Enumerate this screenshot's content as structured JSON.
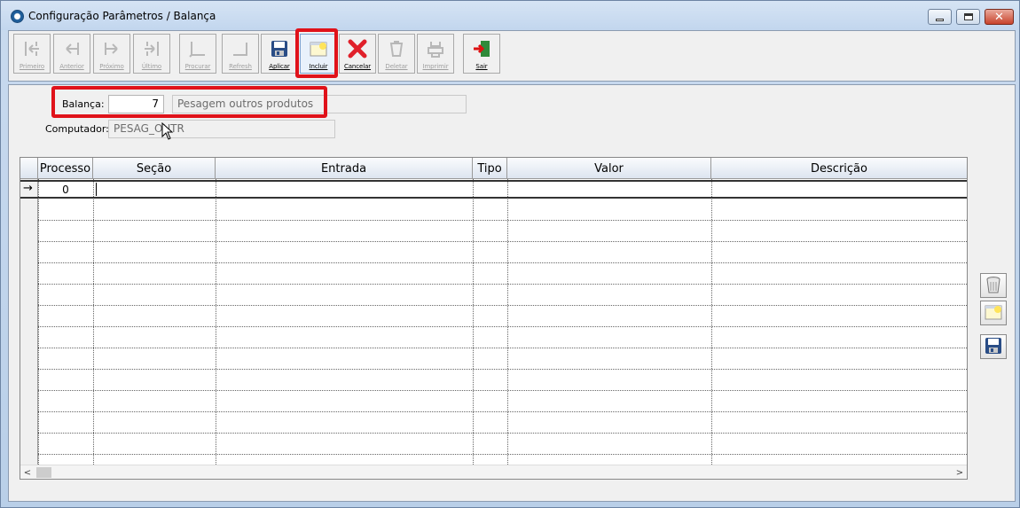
{
  "window": {
    "title": "Configuração Parâmetros / Balança",
    "minimize_icon": "minimize-icon",
    "maximize_icon": "maximize-icon",
    "close_label": "✕"
  },
  "toolbar": {
    "buttons": [
      {
        "label": "Primeiro",
        "icon": "first-record-icon",
        "enabled": false
      },
      {
        "label": "Anterior",
        "icon": "previous-record-icon",
        "enabled": false
      },
      {
        "label": "Próximo",
        "icon": "next-record-icon",
        "enabled": false
      },
      {
        "label": "Último",
        "icon": "last-record-icon",
        "enabled": false
      },
      {
        "label": "Procurar",
        "icon": "search-icon",
        "enabled": false
      },
      {
        "label": "Refresh",
        "icon": "refresh-icon",
        "enabled": false
      },
      {
        "label": "Aplicar",
        "icon": "save-icon",
        "enabled": true
      },
      {
        "label": "Incluir",
        "icon": "new-record-icon",
        "enabled": true,
        "highlighted": true
      },
      {
        "label": "Cancelar",
        "icon": "cancel-icon",
        "enabled": true
      },
      {
        "label": "Deletar",
        "icon": "delete-icon",
        "enabled": false
      },
      {
        "label": "Imprimir",
        "icon": "print-icon",
        "enabled": false
      },
      {
        "label": "Sair",
        "icon": "exit-icon",
        "enabled": true
      }
    ]
  },
  "form": {
    "balanca_label": "Balança:",
    "balanca_value": "7",
    "balanca_desc": "Pesagem outros produtos",
    "computador_label": "Computador:",
    "computador_value": "PESAG_OUTR"
  },
  "grid": {
    "columns": [
      "Processo",
      "Seção",
      "Entrada",
      "Tipo",
      "Valor",
      "Descrição"
    ],
    "rows": [
      {
        "processo": "0",
        "secao": "",
        "entrada": "",
        "tipo": "",
        "valor": "",
        "descricao": ""
      }
    ],
    "scroll_left": "<",
    "scroll_right": ">"
  },
  "side_buttons": [
    {
      "icon": "trash-icon"
    },
    {
      "icon": "new-record-icon"
    },
    {
      "icon": "save-icon"
    }
  ],
  "colors": {
    "highlight": "#e0121a",
    "accent": "#1d5d9a"
  }
}
